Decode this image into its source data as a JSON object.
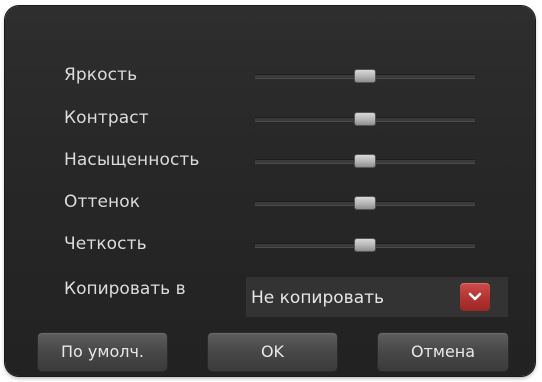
{
  "settings": [
    {
      "label": "Яркость",
      "level": 0.5
    },
    {
      "label": "Контраст",
      "level": 0.5
    },
    {
      "label": "Насыщенность",
      "level": 0.5
    },
    {
      "label": "Оттенок",
      "level": 0.5
    },
    {
      "label": "Четкость",
      "level": 0.5
    }
  ],
  "copy": {
    "label": "Копировать в",
    "selected": "Не копировать"
  },
  "buttons": {
    "default_label": "По умолч.",
    "ok_label": "OK",
    "cancel_label": "Отмена"
  },
  "colors": {
    "dropdown_accent": "#b23330",
    "panel_background": "#272727"
  },
  "icons": {
    "dropdown": "chevron-down-icon"
  }
}
